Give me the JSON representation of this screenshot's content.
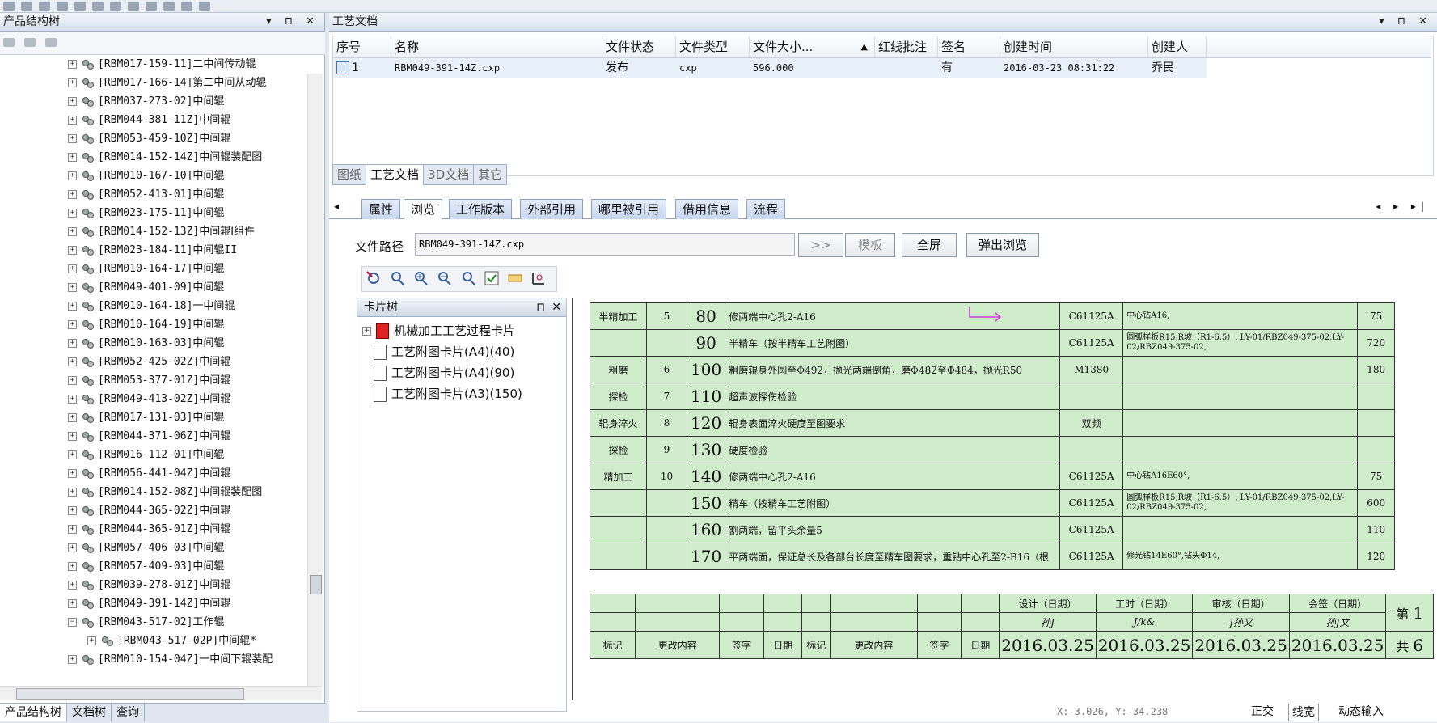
{
  "left_pane": {
    "title": "产品结构树",
    "controls": "▾ ⊓ ✕",
    "tree_items": [
      {
        "label": "[RBM017-159-11]二中间传动辊"
      },
      {
        "label": "[RBM017-166-14]第二中间从动辊"
      },
      {
        "label": "[RBM037-273-02]中间辊"
      },
      {
        "label": "[RBM044-381-11Z]中间辊"
      },
      {
        "label": "[RBM053-459-10Z]中间辊"
      },
      {
        "label": "[RBM014-152-14Z]中间辊装配图"
      },
      {
        "label": "[RBM010-167-10]中间辊"
      },
      {
        "label": "[RBM052-413-01]中间辊"
      },
      {
        "label": "[RBM023-175-11]中间辊"
      },
      {
        "label": "[RBM014-152-13Z]中间辊Ⅰ组件"
      },
      {
        "label": "[RBM023-184-11]中间辊II"
      },
      {
        "label": "[RBM010-164-17]中间辊"
      },
      {
        "label": "[RBM049-401-09]中间辊"
      },
      {
        "label": "[RBM010-164-18]一中间辊"
      },
      {
        "label": "[RBM010-164-19]中间辊"
      },
      {
        "label": "[RBM010-163-03]中间辊"
      },
      {
        "label": "[RBM052-425-02Z]中间辊"
      },
      {
        "label": "[RBM053-377-01Z]中间辊"
      },
      {
        "label": "[RBM049-413-02Z]中间辊"
      },
      {
        "label": "[RBM017-131-03]中间辊"
      },
      {
        "label": "[RBM044-371-06Z]中间辊"
      },
      {
        "label": "[RBM016-112-01]中间辊"
      },
      {
        "label": "[RBM056-441-04Z]中间辊"
      },
      {
        "label": "[RBM014-152-08Z]中间辊装配图"
      },
      {
        "label": "[RBM044-365-02Z]中间辊"
      },
      {
        "label": "[RBM044-365-01Z]中间辊"
      },
      {
        "label": "[RBM057-406-03]中间辊"
      },
      {
        "label": "[RBM057-409-03]中间辊"
      },
      {
        "label": "[RBM039-278-01Z]中间辊"
      },
      {
        "label": "[RBM049-391-14Z]中间辊"
      },
      {
        "label": "[RBM043-517-02]工作辊"
      },
      {
        "label": "[RBM043-517-02P]中间辊*"
      },
      {
        "label": "[RBM010-154-04Z]一中间下辊装配"
      }
    ],
    "bottom_tabs": [
      "产品结构树",
      "文档树",
      "查询"
    ]
  },
  "doc_pane": {
    "title": "工艺文档",
    "controls": "▾ ⊓ ✕",
    "columns": [
      "序号",
      "名称",
      "文件状态",
      "文件类型",
      "文件大小...",
      "红线批注",
      "签名",
      "创建时间",
      "创建人"
    ],
    "sort_indicator": "▲",
    "rows": [
      {
        "no": "1",
        "name": "RBM049-391-14Z.cxp",
        "status": "发布",
        "type": "cxp",
        "size": "596.000",
        "redline": "",
        "sign": "有",
        "created": "2016-03-23 08:31:22",
        "creator": "乔民"
      }
    ],
    "doc_tabs": [
      "图纸",
      "工艺文档",
      "3D文档",
      "其它"
    ]
  },
  "detail": {
    "nav_first": "◂",
    "nav_right": "◂ ▸ ▸|",
    "tabs": [
      "属性",
      "浏览",
      "工作版本",
      "外部引用",
      "哪里被引用",
      "借用信息",
      "流程"
    ],
    "path_label": "文件路径",
    "path_value": "RBM049-391-14Z.cxp",
    "buttons": {
      "next": ">>",
      "template": "模板",
      "fullscreen": "全屏",
      "popup": "弹出浏览"
    }
  },
  "card_tree": {
    "title": "卡片树",
    "nodes": [
      "机械加工工艺过程卡片",
      "工艺附图卡片(A4)(40)",
      "工艺附图卡片(A4)(90)",
      "工艺附图卡片(A3)(150)"
    ]
  },
  "process_rows": [
    {
      "op": "半精加工",
      "seq": "5",
      "step": "80",
      "content": "修两端中心孔2-A16",
      "equip": "C61125A",
      "tool": "中心钻A16,",
      "time": "75"
    },
    {
      "op": "",
      "seq": "",
      "step": "90",
      "content": "半精车（按半精车工艺附图）",
      "equip": "C61125A",
      "tool": "圆弧样板R15,R坡（R1-6.5）, LY-01/RBZ049-375-02,LY-02/RBZ049-375-02,",
      "time": "720"
    },
    {
      "op": "粗磨",
      "seq": "6",
      "step": "100",
      "content": "粗磨辊身外圆至Ф492，抛光两端倒角，磨Ф482至Ф484，抛光R50",
      "equip": "M1380",
      "tool": "",
      "time": "180"
    },
    {
      "op": "探检",
      "seq": "7",
      "step": "110",
      "content": "超声波探伤检验",
      "equip": "",
      "tool": "",
      "time": ""
    },
    {
      "op": "辊身淬火",
      "seq": "8",
      "step": "120",
      "content": "辊身表面淬火硬度至图要求",
      "equip": "双频",
      "tool": "",
      "time": ""
    },
    {
      "op": "探检",
      "seq": "9",
      "step": "130",
      "content": "硬度检验",
      "equip": "",
      "tool": "",
      "time": ""
    },
    {
      "op": "精加工",
      "seq": "10",
      "step": "140",
      "content": "修两端中心孔2-A16",
      "equip": "C61125A",
      "tool": "中心钻A16E60°,",
      "time": "75"
    },
    {
      "op": "",
      "seq": "",
      "step": "150",
      "content": "精车（按精车工艺附图）",
      "equip": "C61125A",
      "tool": "圆弧样板R15,R坡（R1-6.5）, LY-01/RBZ049-375-02,LY-02/RBZ049-375-02,",
      "time": "600"
    },
    {
      "op": "",
      "seq": "",
      "step": "160",
      "content": "割两端，留平头余量5",
      "equip": "C61125A",
      "tool": "",
      "time": "110"
    },
    {
      "op": "",
      "seq": "",
      "step": "170",
      "content": "平两端面，保证总长及各部台长度至精车图要求，重钻中心孔至2-B16（根",
      "equip": "C61125A",
      "tool": "修光钻14E60°,钻头Ф14,",
      "time": "120"
    }
  ],
  "footer": {
    "roles": [
      "设计（日期）",
      "工时（日期）",
      "审核（日期）",
      "会签（日期）"
    ],
    "signatures": [
      "孙J",
      "J/k&",
      "J孙又",
      "孙J文"
    ],
    "dates": [
      "2016.03.25",
      "2016.03.25",
      "2016.03.25",
      "2016.03.25"
    ],
    "page_label": "第",
    "page_value": "1",
    "total_label": "共",
    "total_value": "6",
    "change_headers": [
      "标记",
      "更改内容",
      "签字",
      "日期",
      "标记",
      "更改内容",
      "签字",
      "日期"
    ]
  },
  "status": {
    "coords": "X:-3.026, Y:-34.238",
    "toggles": [
      "正交",
      "线宽",
      "动态输入"
    ]
  },
  "colors": {
    "cell_fill": "#cfeccb",
    "row_highlight": "#e8f0fa",
    "arrow": "#d33cd6"
  }
}
